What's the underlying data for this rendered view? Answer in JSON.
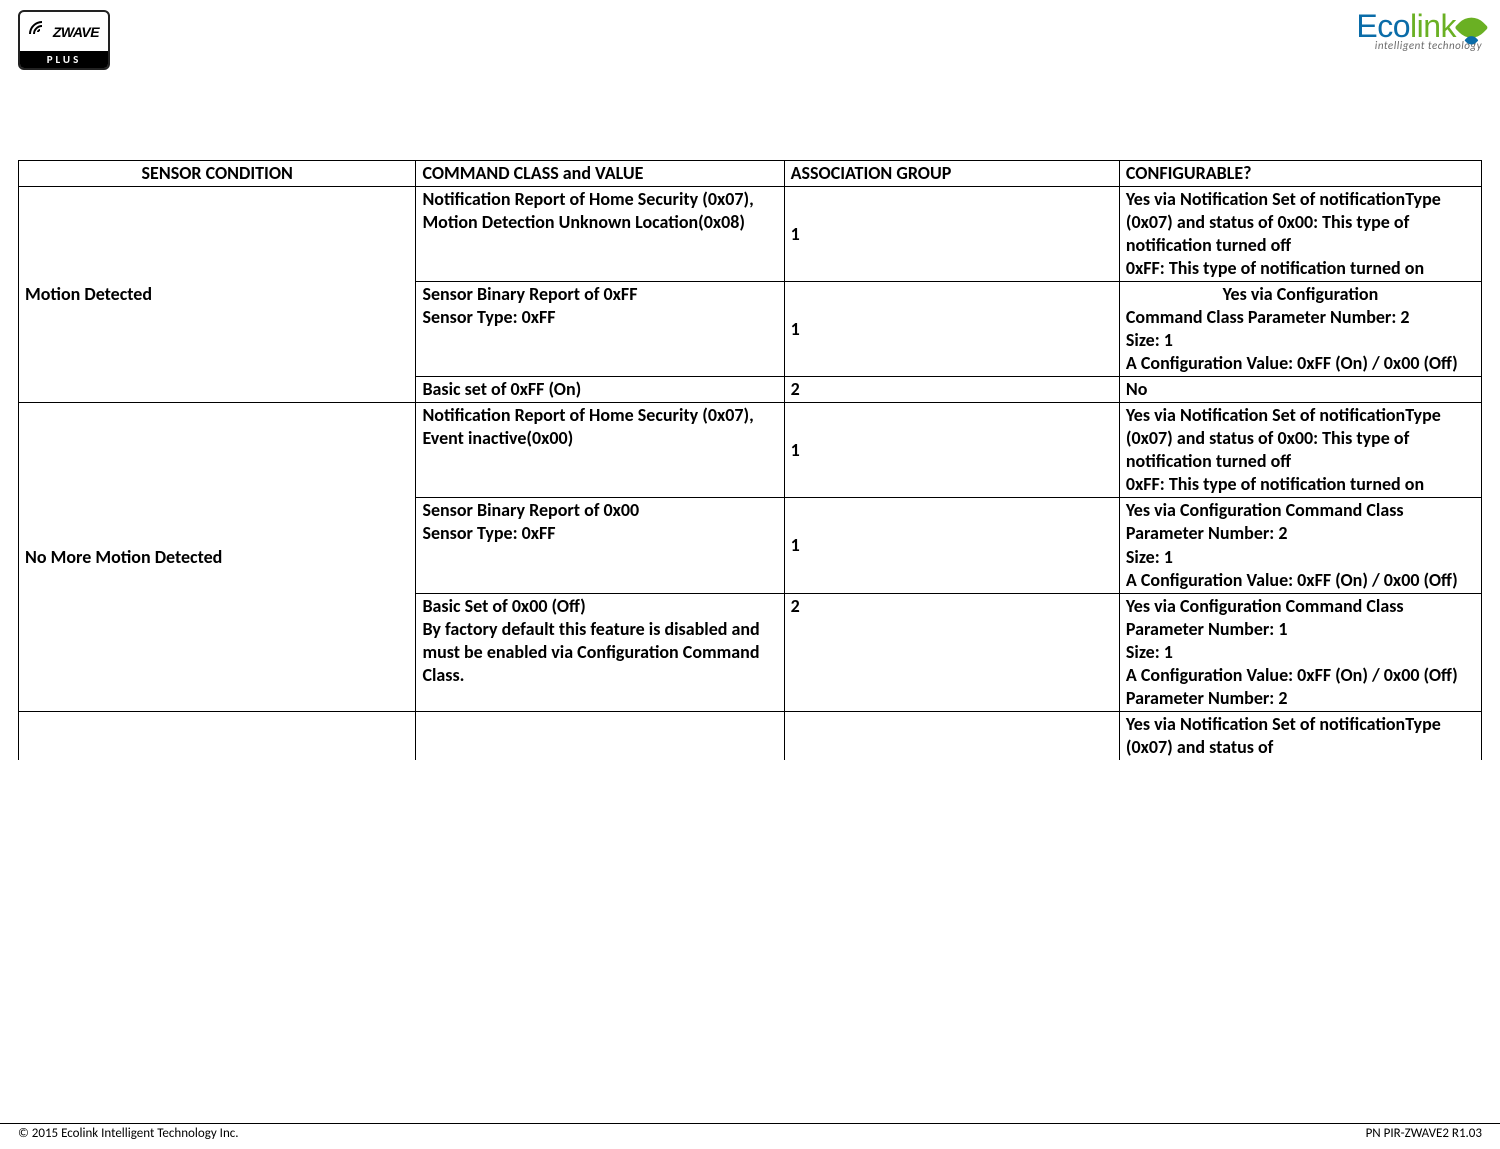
{
  "header": {
    "zwave_brand": "WAVE",
    "zwave_prefix": "Z",
    "zwave_plus": "PLUS",
    "ecolink_eco": "Eco",
    "ecolink_link": "link",
    "ecolink_tag": "intelligent technology"
  },
  "table": {
    "headers": {
      "c1": "SENSOR CONDITION",
      "c2": "COMMAND CLASS and VALUE",
      "c3": "ASSOCIATION GROUP",
      "c4": "CONFIGURABLE?"
    },
    "motion_detected": {
      "label": "Motion Detected",
      "rows": [
        {
          "cmd": "Notification Report of Home Security (0x07), Motion Detection Unknown Location(0x08)",
          "group": "1",
          "cfg": "Yes via Notification Set of notificationType (0x07)  and status of 0x00: This type of notification turned off\n0xFF: This type of notification turned on"
        },
        {
          "cmd": "Sensor Binary Report of 0xFF\nSensor Type: 0xFF",
          "group": "1",
          "cfg_first": "Yes via Configuration",
          "cfg_rest": "Command Class  Parameter Number: 2\nSize: 1\nA Configuration Value: 0xFF (On) / 0x00 (Off)"
        },
        {
          "cmd": "Basic set of 0xFF (On)",
          "group": "2",
          "cfg": "No"
        }
      ]
    },
    "no_more_motion": {
      "label": "No More Motion Detected",
      "rows": [
        {
          "cmd": "Notification Report of Home Security (0x07), Event inactive(0x00)",
          "group": "1",
          "cfg": "Yes via Notification Set of notificationType (0x07)  and status of 0x00: This type of notification turned off\n0xFF: This type of notification turned on"
        },
        {
          "cmd": "Sensor Binary Report of 0x00\nSensor Type: 0xFF",
          "group": "1",
          "cfg": "Yes via Configuration Command Class\nParameter Number: 2\nSize: 1\nA Configuration Value: 0xFF (On) / 0x00 (Off)"
        },
        {
          "cmd": "Basic Set of 0x00 (Off)\nBy factory default this feature is disabled and must be enabled via Configuration Command Class.",
          "group": "2",
          "cfg": "Yes via Configuration Command Class\nParameter Number: 1\nSize: 1\nA Configuration Value: 0xFF (On) / 0x00 (Off)  Parameter Number: 2\n "
        }
      ]
    },
    "cutoff_row": {
      "cmd": "",
      "group": "",
      "cfg": "Yes via Notification Set of notificationType (0x07)  and status of"
    }
  },
  "footer": {
    "left": "© 2015 Ecolink Intelligent Technology Inc.",
    "right": "PN PIR-ZWAVE2  R1.03"
  }
}
